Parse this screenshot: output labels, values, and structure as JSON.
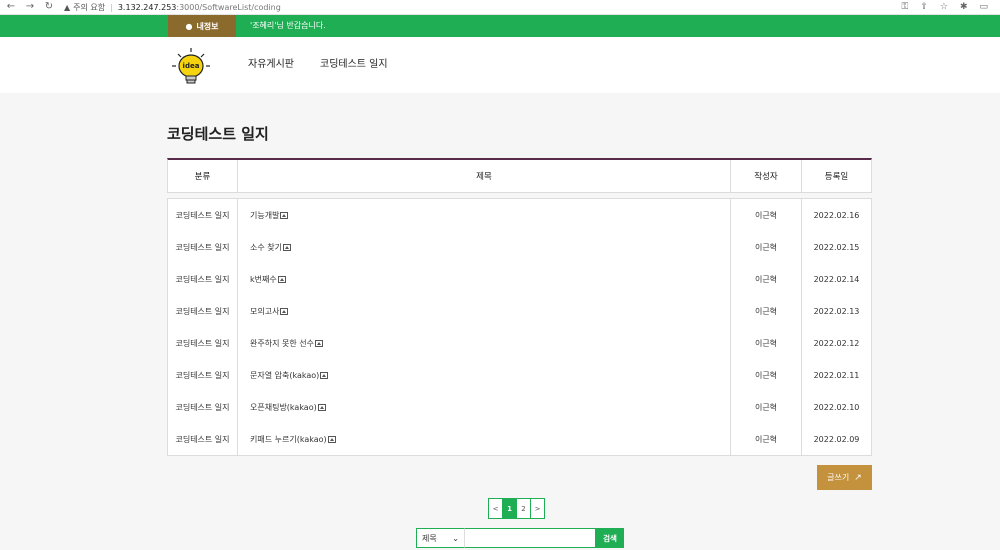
{
  "browser": {
    "security_label": "주의 요함",
    "url_host": "3.132.247.253",
    "url_path": ":3000/SoftwareList/coding"
  },
  "topbar": {
    "my_info_label": "내정보",
    "greeting": "'조혜리'님 반갑습니다."
  },
  "header": {
    "logo_text": "idea",
    "menu": [
      "자유게시판",
      "코딩테스트 일지"
    ]
  },
  "page": {
    "title": "코딩테스트 일지"
  },
  "table": {
    "headers": [
      "분류",
      "제목",
      "작성자",
      "등록일"
    ],
    "rows": [
      {
        "category": "코딩테스트 일지",
        "title": "기능개발",
        "author": "이근혁",
        "date": "2022.02.16"
      },
      {
        "category": "코딩테스트 일지",
        "title": "소수 찾기",
        "author": "이근혁",
        "date": "2022.02.15"
      },
      {
        "category": "코딩테스트 일지",
        "title": "k번째수",
        "author": "이근혁",
        "date": "2022.02.14"
      },
      {
        "category": "코딩테스트 일지",
        "title": "모의고사",
        "author": "이근혁",
        "date": "2022.02.13"
      },
      {
        "category": "코딩테스트 일지",
        "title": "완주하지 못한 선수",
        "author": "이근혁",
        "date": "2022.02.12"
      },
      {
        "category": "코딩테스트 일지",
        "title": "문자열 압축(kakao)",
        "author": "이근혁",
        "date": "2022.02.11"
      },
      {
        "category": "코딩테스트 일지",
        "title": "오픈채팅방(kakao)",
        "author": "이근혁",
        "date": "2022.02.10"
      },
      {
        "category": "코딩테스트 일지",
        "title": "키패드 누르기(kakao)",
        "author": "이근혁",
        "date": "2022.02.09"
      }
    ]
  },
  "actions": {
    "write_label": "글쓰기"
  },
  "pagination": {
    "prev": "<",
    "pages": [
      "1",
      "2"
    ],
    "next": ">",
    "current": "1"
  },
  "search": {
    "select_value": "제목",
    "input_value": "",
    "button_label": "검색"
  },
  "colors": {
    "green": "#1fae54",
    "brown": "#8b6a2e",
    "gold": "#c4913c",
    "header_border": "#5a2a4a"
  }
}
